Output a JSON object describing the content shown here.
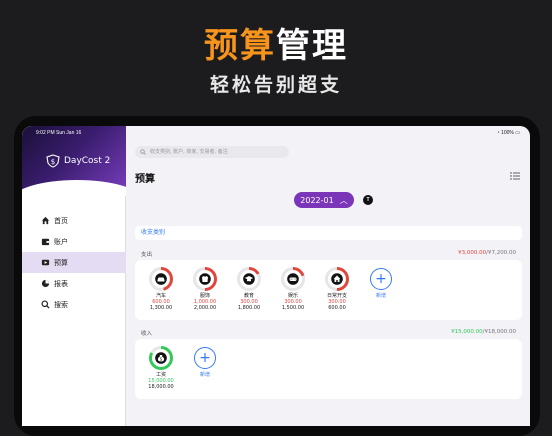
{
  "promo": {
    "title_accent": "预算",
    "title_rest": "管理",
    "subtitle": "轻松告别超支"
  },
  "status": {
    "time": "9:02 PM   Sun Jan 16",
    "battery": "100%"
  },
  "app": {
    "name": "DayCost 2"
  },
  "nav": [
    {
      "label": "首页",
      "icon": "home-icon",
      "active": false
    },
    {
      "label": "账户",
      "icon": "wallet-icon",
      "active": false
    },
    {
      "label": "预算",
      "icon": "budget-icon",
      "active": true
    },
    {
      "label": "报表",
      "icon": "pie-chart-icon",
      "active": false
    },
    {
      "label": "搜索",
      "icon": "search-icon",
      "active": false
    }
  ],
  "search": {
    "placeholder": "收支类别, 账户, 商家, 交易者, 备注"
  },
  "page": {
    "title": "预算",
    "period": "2022-01",
    "badge": "T",
    "category_link": "收支类别"
  },
  "expense": {
    "label": "支出",
    "used_total": "¥3,000.00",
    "budget_total": "/¥7,200.00",
    "categories": [
      {
        "name": "汽车",
        "used": "600.00",
        "budget": "1,300.00",
        "icon": "car-icon",
        "progress": 0.46
      },
      {
        "name": "服饰",
        "used": "1,000.00",
        "budget": "2,000.00",
        "icon": "clothing-icon",
        "progress": 0.5
      },
      {
        "name": "教育",
        "used": "300.00",
        "budget": "1,800.00",
        "icon": "graduation-cap-icon",
        "progress": 0.17
      },
      {
        "name": "娱乐",
        "used": "300.00",
        "budget": "1,500.00",
        "icon": "gamepad-icon",
        "progress": 0.2
      },
      {
        "name": "日常开支",
        "used": "300.00",
        "budget": "600.00",
        "icon": "house-icon",
        "progress": 0.5
      }
    ],
    "add_label": "新增"
  },
  "income": {
    "label": "收入",
    "used_total": "¥15,000.00",
    "budget_total": "/¥18,000.00",
    "categories": [
      {
        "name": "工资",
        "used": "15,000.00",
        "budget": "18,000.00",
        "icon": "money-bag-icon",
        "progress": 0.83
      }
    ],
    "add_label": "新增"
  },
  "colors": {
    "accent": "#f7941d",
    "brand": "#7b35b8",
    "expense": "#e0463c",
    "income": "#34c759",
    "link": "#3478f6"
  }
}
